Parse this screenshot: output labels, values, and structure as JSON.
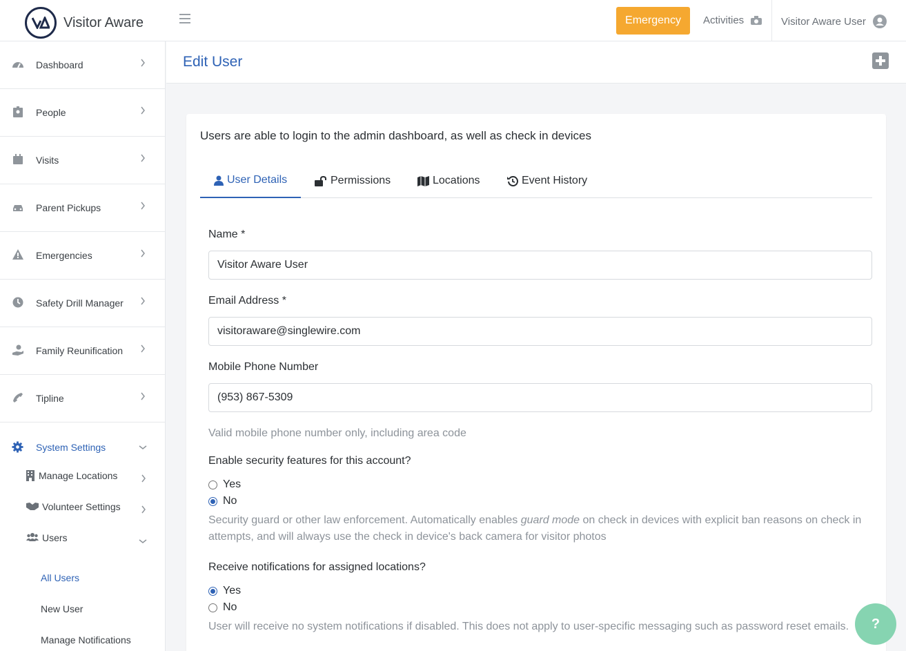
{
  "app": {
    "name": "Visitor Aware"
  },
  "topbar": {
    "emergency_label": "Emergency",
    "activities_label": "Activities",
    "user_label": "Visitor Aware User"
  },
  "sidebar": {
    "items": [
      {
        "label": "Dashboard",
        "icon": "dashboard-icon"
      },
      {
        "label": "People",
        "icon": "id-badge-icon"
      },
      {
        "label": "Visits",
        "icon": "calendar-icon"
      },
      {
        "label": "Parent Pickups",
        "icon": "car-icon"
      },
      {
        "label": "Emergencies",
        "icon": "warning-icon"
      },
      {
        "label": "Safety Drill Manager",
        "icon": "clock-icon"
      },
      {
        "label": "Family Reunification",
        "icon": "hand-holding-icon"
      },
      {
        "label": "Tipline",
        "icon": "phone-icon"
      }
    ],
    "system_settings": {
      "label": "System Settings",
      "children": [
        {
          "label": "Manage Locations"
        },
        {
          "label": "Volunteer Settings"
        },
        {
          "label": "Users"
        }
      ],
      "users_children": [
        {
          "label": "All Users"
        },
        {
          "label": "New User"
        },
        {
          "label": "Manage Notifications"
        }
      ]
    }
  },
  "page": {
    "title": "Edit User"
  },
  "card": {
    "intro": "Users are able to login to the admin dashboard, as well as check in devices",
    "tabs": [
      {
        "label": "User Details"
      },
      {
        "label": "Permissions"
      },
      {
        "label": "Locations"
      },
      {
        "label": "Event History"
      }
    ]
  },
  "form": {
    "name_label": "Name *",
    "name_value": "Visitor Aware User",
    "email_label": "Email Address *",
    "email_value": "visitoraware@singlewire.com",
    "phone_label": "Mobile Phone Number",
    "phone_value": "(953) 867-5309",
    "phone_help": "Valid mobile phone number only, including area code",
    "security_label": "Enable security features for this account?",
    "security_yes": "Yes",
    "security_no": "No",
    "security_selected": "No",
    "security_help_1": "Security guard or other law enforcement. Automatically enables ",
    "security_help_em": "guard mode",
    "security_help_2": " on check in devices with explicit ban reasons on check in attempts, and will always use the check in device's back camera for visitor photos",
    "notif_label": "Receive notifications for assigned locations?",
    "notif_yes": "Yes",
    "notif_no": "No",
    "notif_selected": "Yes",
    "notif_help": "User will receive no system notifications if disabled. This does not apply to user-specific messaging such as password reset emails."
  },
  "help_button": {
    "label": "?"
  },
  "colors": {
    "accent": "#2e62b5",
    "emergency": "#f5a830",
    "help_fab": "#86d4b1"
  }
}
